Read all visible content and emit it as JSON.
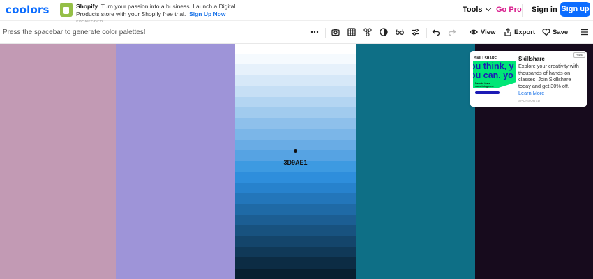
{
  "header": {
    "logo": "coolors",
    "ad": {
      "brand": "Shopify",
      "text": "Turn your passion into a business. Launch a Digital Products store with your Shopify free trial.",
      "cta": "Sign Up Now",
      "sponsored": "SPONSORED"
    },
    "tools_label": "Tools",
    "gopro_label": "Go Pro",
    "signin_label": "Sign in",
    "signup_label": "Sign up"
  },
  "toolbar": {
    "hint": "Press the spacebar to generate color palettes!",
    "icons": [
      "more-icon",
      "camera-icon",
      "grid-icon",
      "share-network-icon",
      "contrast-icon",
      "glasses-icon",
      "sliders-icon",
      "undo-icon",
      "redo-icon",
      "eye-icon",
      "export-icon",
      "heart-icon",
      "menu-icon"
    ],
    "view_label": "View",
    "export_label": "Export",
    "save_label": "Save"
  },
  "palette": {
    "colors": [
      "#C29AB4",
      "#9E94D8",
      "#3D9AE1",
      "#0E6F86",
      "#170B1D"
    ],
    "selected_index": 2,
    "selected_hex": "3D9AE1",
    "shades": [
      "#F5FAFE",
      "#E6F1FB",
      "#D6E8F8",
      "#C6DFF5",
      "#B3D5F2",
      "#A1CBEE",
      "#8EC0EB",
      "#7BB6E8",
      "#69ACE5",
      "#56A3E3",
      "#3D9AE1",
      "#2E8EDC",
      "#2782CD",
      "#2376BA",
      "#1F6AA6",
      "#1C5E93",
      "#18527F",
      "#14456B",
      "#103958",
      "#0C2C44",
      "#081F30"
    ]
  },
  "ad_card": {
    "hide_label": "HIDE",
    "image_brand": "SKILLSHARE",
    "image_slogan": "ou think, y\nou can. yo",
    "image_sub": "Dare to learn something new.",
    "title": "Skillshare",
    "body": "Explore your creativity with thousands of hands-on classes. Join Skillshare today and get 30% off.",
    "link": "Learn More",
    "sponsored": "SPONSORED"
  }
}
